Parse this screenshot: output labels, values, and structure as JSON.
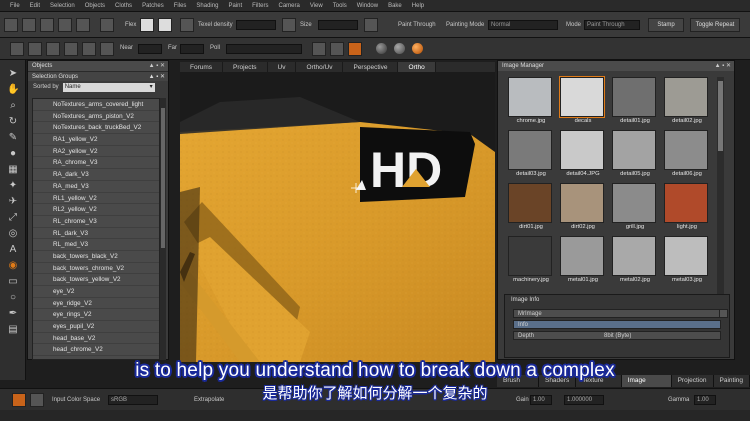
{
  "menu": [
    "File",
    "Edit",
    "Selection",
    "Objects",
    "Cloths",
    "Patches",
    "Files",
    "Shading",
    "Paint",
    "Filters",
    "Camera",
    "View",
    "Tools",
    "Window",
    "Bake",
    "Help"
  ],
  "toolbar1": {
    "flex_label": "Flex",
    "texel_density_label": "Texel density",
    "size_label": "Size",
    "paint_through_label": "Paint Through",
    "painting_mode_label": "Painting Mode",
    "painting_mode_value": "Normal",
    "mode_label": "Mode",
    "mode_value": "Paint Through",
    "stamp_label": "Stamp",
    "toggle_repeat_label": "Toggle Repeat"
  },
  "toolbar2": {
    "near_label": "Near",
    "far_label": "Far",
    "poll_label": "Poll"
  },
  "objects_panel": {
    "title": "Objects",
    "selection_groups_title": "Selection Groups",
    "sorted_by_label": "Sorted by",
    "sorted_by_value": "Name",
    "items": [
      "NoTextures_arms_covered_light",
      "NoTextures_arms_piston_V2",
      "NoTextures_back_truckBed_V2",
      "RA1_yellow_V2",
      "RA2_yellow_V2",
      "RA_chrome_V3",
      "RA_dark_V3",
      "RA_med_V3",
      "RL1_yellow_V2",
      "RL2_yellow_V2",
      "RL_chrome_V3",
      "RL_dark_V3",
      "RL_med_V3",
      "back_towers_black_V2",
      "back_towers_chrome_V2",
      "back_towers_yellow_V2",
      "eye_V2",
      "eye_ridge_V2",
      "eye_rings_V2",
      "eyes_pupil_V2",
      "head_base_V2",
      "head_chrome_V2"
    ]
  },
  "view_tabs": [
    "Forums",
    "Projects",
    "Uv",
    "Ortho/Uv",
    "Perspective",
    "Ortho"
  ],
  "view_tabs_active": "Ortho",
  "viewport": {
    "sign_text": "HD"
  },
  "image_manager": {
    "title": "Image Manager",
    "thumbnails": [
      {
        "name": "chrome.jpg",
        "color": "#b9bcbf",
        "selected": false
      },
      {
        "name": "decals",
        "color": "#d9d9d9",
        "selected": true
      },
      {
        "name": "detail01.jpg",
        "color": "#6f6f6f",
        "selected": false
      },
      {
        "name": "detail02.jpg",
        "color": "#9d9b94",
        "selected": false
      },
      {
        "name": "detail03.jpg",
        "color": "#7a7a7a",
        "selected": false
      },
      {
        "name": "detail04.JPG",
        "color": "#c9c9c9",
        "selected": false
      },
      {
        "name": "detail05.jpg",
        "color": "#a3a3a3",
        "selected": false
      },
      {
        "name": "detail06.jpg",
        "color": "#8c8c8c",
        "selected": false
      },
      {
        "name": "dirt01.jpg",
        "color": "#6a4427",
        "selected": false
      },
      {
        "name": "dirt02.jpg",
        "color": "#a8937b",
        "selected": false
      },
      {
        "name": "grill.jpg",
        "color": "#8b8b8b",
        "selected": false
      },
      {
        "name": "light.jpg",
        "color": "#b04a2a",
        "selected": false
      },
      {
        "name": "machinery.jpg",
        "color": "#3a3a3a",
        "selected": false
      },
      {
        "name": "metal01.jpg",
        "color": "#9a9a9a",
        "selected": false
      },
      {
        "name": "metal02.jpg",
        "color": "#a9a9a9",
        "selected": false
      },
      {
        "name": "metal03.jpg",
        "color": "#bdbdbd",
        "selected": false
      }
    ],
    "image_info_title": "Image Info",
    "info_rows": [
      "MrImage",
      "Info",
      "Depth",
      "8bit (Byte)"
    ]
  },
  "bottom_tabs": [
    "Brush Editor",
    "Shaders",
    "Texture Editor",
    "Image Manager",
    "Projection",
    "Painting"
  ],
  "bottom_tabs_active": "Image Manager",
  "statusbar": {
    "input_color_space_label": "Input Color Space",
    "input_color_space_value": "sRGB",
    "extrapolate_label": "Extrapolate",
    "gain_label": "Gain",
    "gain_value": "1.00",
    "gain_value2": "1.000000",
    "gamma_label": "Gamma",
    "gamma_value": "1.00"
  },
  "subtitle_en": "is to help you understand how to break down a complex",
  "subtitle_zh": "是帮助你了解如何分解一个复杂的"
}
